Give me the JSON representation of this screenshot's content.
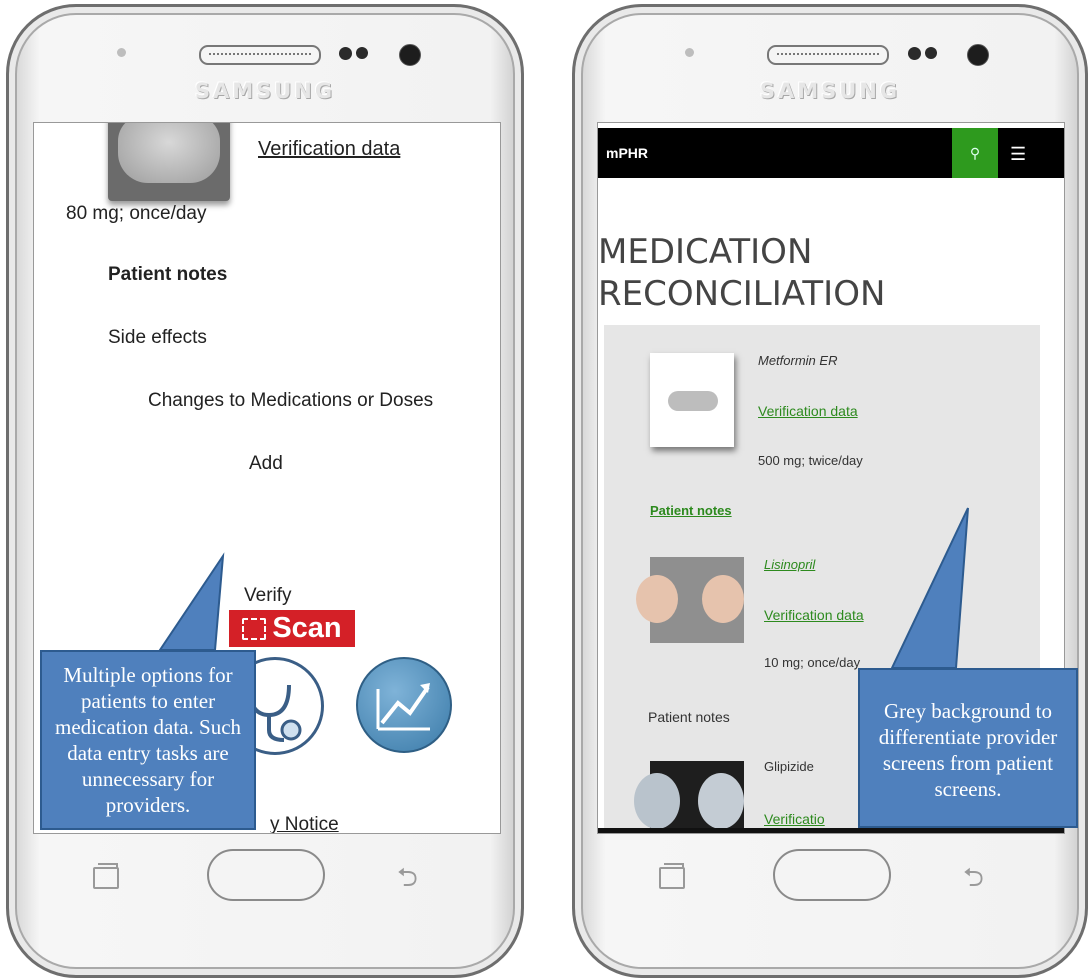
{
  "left_phone": {
    "brand": "SAMSUNG",
    "verification_link": "Verification data",
    "dose": "80 mg; once/day",
    "patient_notes": "Patient notes",
    "side_effects": "Side effects",
    "changes": "Changes to Medications or Doses",
    "add": "Add",
    "scan": "Scan",
    "verify": "Verify",
    "notice_partial": "y Notice",
    "callout": "Multiple options for patients to enter medication data. Such data entry tasks are unnecessary for providers."
  },
  "right_phone": {
    "brand": "SAMSUNG",
    "app_title": "mPHR",
    "heading_line1": "MEDICATION",
    "heading_line2": "RECONCILIATION",
    "med1_name": "Metformin ER",
    "med1_verification": "Verification data",
    "med1_dose": "500 mg; twice/day",
    "patient_notes_link": "Patient notes",
    "med2_name": "Lisinopril",
    "med2_verification": "Verification data",
    "med2_dose": "10 mg; once/day",
    "patient_notes_plain": "Patient notes",
    "med3_name": "Glipizide",
    "med3_verification": "Verificatio",
    "callout": "Grey background to differentiate provider screens from patient screens."
  },
  "colors": {
    "link_green": "#2d8a1e",
    "scan_red": "#d42027",
    "callout_blue": "#4f80bd",
    "provider_grey": "#e6e6e6"
  }
}
